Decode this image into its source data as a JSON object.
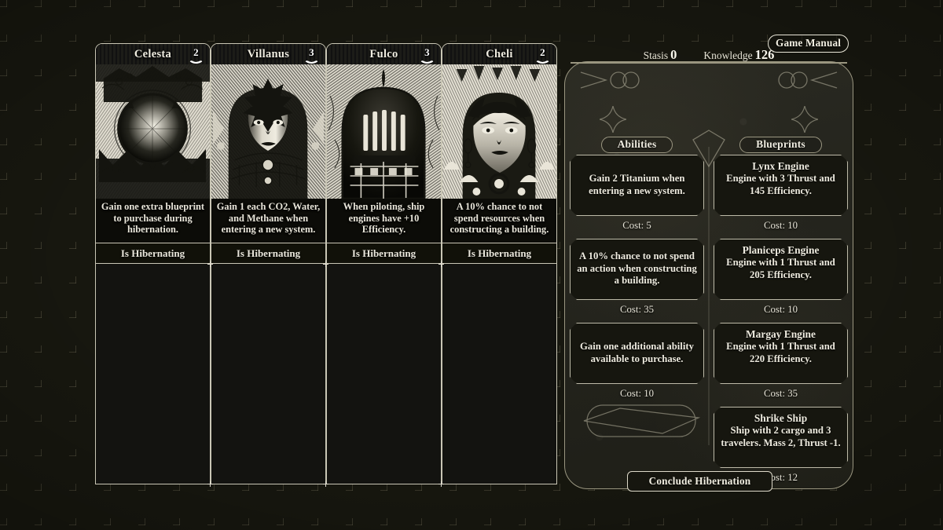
{
  "hud": {
    "stasis_label": "Stasis",
    "stasis_value": "0",
    "knowledge_label": "Knowledge",
    "knowledge_value": "126",
    "game_manual_label": "Game Manual"
  },
  "cards": [
    {
      "name": "Celesta",
      "cost": "2",
      "text": "Gain one extra blueprint to purchase during hibernation.",
      "status": "Is Hibernating",
      "portrait": "celestial-orb-portrait"
    },
    {
      "name": "Villanus",
      "cost": "3",
      "text": "Gain 1 each CO2, Water, and Methane when entering a new system.",
      "status": "Is Hibernating",
      "portrait": "crowned-helm-portrait"
    },
    {
      "name": "Fulco",
      "cost": "3",
      "text": "When piloting, ship engines have +10 Efficiency.",
      "status": "Is Hibernating",
      "portrait": "visored-helm-portrait"
    },
    {
      "name": "Cheli",
      "cost": "2",
      "text": "A 10% chance to not spend resources when constructing a building.",
      "status": "Is Hibernating",
      "portrait": "hooded-figure-portrait"
    }
  ],
  "panel": {
    "abilities_header": "Abilities",
    "blueprints_header": "Blueprints",
    "abilities": [
      {
        "title": "",
        "desc": "Gain 2 Titanium when entering a new system.",
        "cost": "Cost: 5"
      },
      {
        "title": "",
        "desc": "A 10% chance to not spend an action when constructing a building.",
        "cost": "Cost: 35"
      },
      {
        "title": "",
        "desc": "Gain one additional ability available to purchase.",
        "cost": "Cost: 10"
      }
    ],
    "blueprints": [
      {
        "title": "Lynx Engine",
        "desc": "Engine with 3 Thrust and 145 Efficiency.",
        "cost": "Cost: 10"
      },
      {
        "title": "Planiceps Engine",
        "desc": "Engine with 1 Thrust and 205 Efficiency.",
        "cost": "Cost: 10"
      },
      {
        "title": "Margay Engine",
        "desc": "Engine with 1 Thrust and 220 Efficiency.",
        "cost": "Cost: 35"
      },
      {
        "title": "Shrike Ship",
        "desc": "Ship with 2 cargo and 3 travelers. Mass 2, Thrust -1.",
        "cost": "Cost: 12"
      }
    ],
    "conclude_label": "Conclude Hibernation"
  },
  "colors": {
    "background": "#17170f",
    "frame_line": "#c9c6b5",
    "panel_line": "#9a9680",
    "text": "#efece0",
    "card_fill": "#0c0c08"
  }
}
